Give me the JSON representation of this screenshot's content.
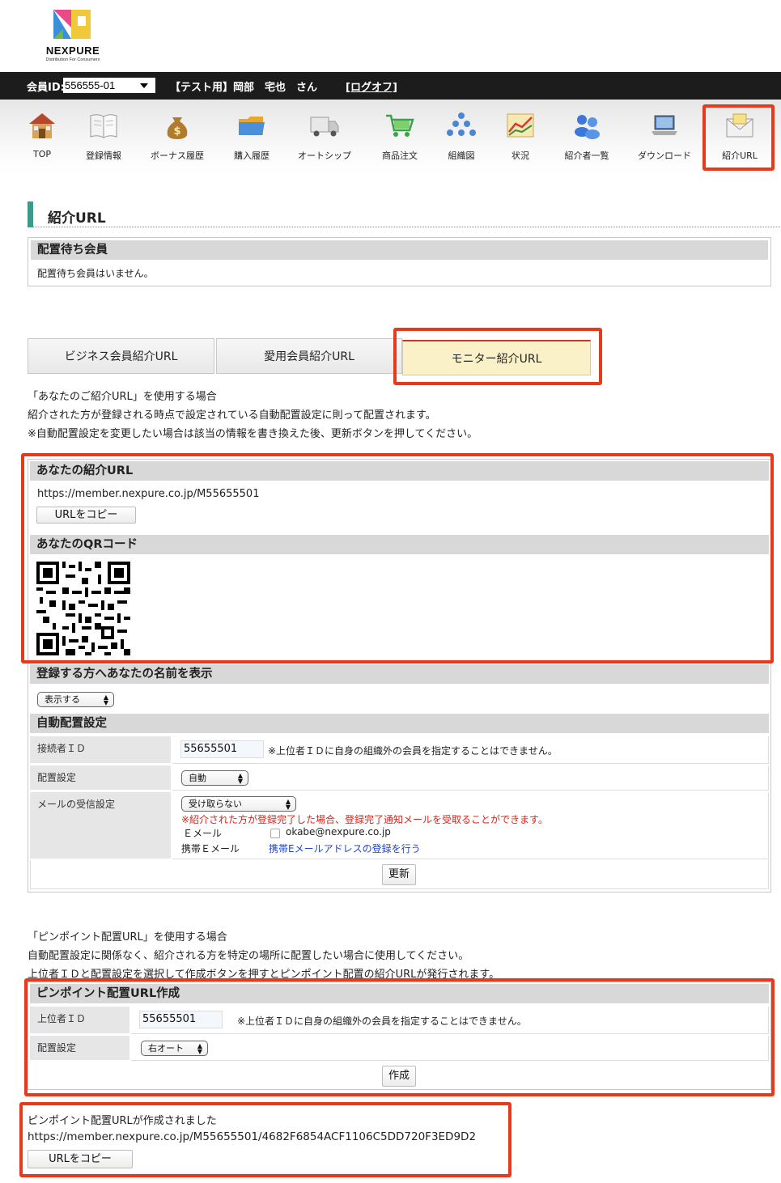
{
  "header": {
    "logo_text": "NEXPURE",
    "logo_sub": "Distribution For Consumers",
    "member_id_label": "会員ID:",
    "member_id_value": "556555-01",
    "user_name": "【テスト用】岡部　宅也　さん",
    "logoff": "[ログオフ]"
  },
  "nav": [
    {
      "label": "TOP",
      "icon": "house-icon"
    },
    {
      "label": "登録情報",
      "icon": "book-icon"
    },
    {
      "label": "ボーナス履歴",
      "icon": "money-bag-icon"
    },
    {
      "label": "購入履歴",
      "icon": "folder-icon"
    },
    {
      "label": "オートシップ",
      "icon": "truck-icon"
    },
    {
      "label": "商品注文",
      "icon": "cart-icon"
    },
    {
      "label": "組織図",
      "icon": "org-chart-icon"
    },
    {
      "label": "状況",
      "icon": "chart-icon"
    },
    {
      "label": "紹介者一覧",
      "icon": "people-icon"
    },
    {
      "label": "ダウンロード",
      "icon": "laptop-icon"
    },
    {
      "label": "紹介URL",
      "icon": "envelope-icon"
    }
  ],
  "page_title": "紹介URL",
  "waiting": {
    "heading": "配置待ち会員",
    "message": "配置待ち会員はいません。"
  },
  "tabs": [
    {
      "label": "ビジネス会員紹介URL"
    },
    {
      "label": "愛用会員紹介URL"
    },
    {
      "label": "モニター紹介URL"
    }
  ],
  "intro": {
    "line1": "「あなたのご紹介URL」を使用する場合",
    "line2": "紹介された方が登録される時点で設定されている自動配置設定に則って配置されます。",
    "line3": "※自動配置設定を変更したい場合は該当の情報を書き換えた後、更新ボタンを押してください。"
  },
  "your_url": {
    "heading": "あなたの紹介URL",
    "url": "https://member.nexpure.co.jp/M55655501",
    "copy_button": "URLをコピー"
  },
  "qr": {
    "heading": "あなたのQRコード"
  },
  "display_name": {
    "heading": "登録する方へあなたの名前を表示",
    "select_value": "表示する"
  },
  "auto_placement": {
    "heading": "自動配置設定",
    "connector_label": "接続者ＩＤ",
    "connector_value": "55655501",
    "connector_note": "※上位者ＩＤに自身の組織外の会員を指定することはできません。",
    "placement_label": "配置設定",
    "placement_value": "自動",
    "mail_label": "メールの受信設定",
    "mail_value": "受け取らない",
    "mail_note": "※紹介された方が登録完了した場合、登録完了通知メールを受取ることができます。",
    "email_label": "Ｅメール",
    "email_value": "okabe@nexpure.co.jp",
    "mobile_label": "携帯Ｅメール",
    "mobile_link": "携帯Eメールアドレスの登録を行う",
    "update_button": "更新"
  },
  "pinpoint_intro": {
    "line1": "「ピンポイント配置URL」を使用する場合",
    "line2": "自動配置設定に関係なく、紹介される方を特定の場所に配置したい場合に使用してください。",
    "line3": "上位者ＩＤと配置設定を選択して作成ボタンを押すとピンポイント配置の紹介URLが発行されます。"
  },
  "pinpoint": {
    "heading": "ピンポイント配置URL作成",
    "upper_label": "上位者ＩＤ",
    "upper_value": "55655501",
    "upper_note": "※上位者ＩＤに自身の組織外の会員を指定することはできません。",
    "placement_label": "配置設定",
    "placement_value": "右オート",
    "create_button": "作成"
  },
  "result": {
    "message": "ピンポイント配置URLが作成されました",
    "url": "https://member.nexpure.co.jp/M55655501/4682F6854ACF1106C5DD720F3ED9D2",
    "copy_button": "URLをコピー"
  },
  "colors": {
    "accent_teal": "#3b9b88",
    "highlight_red": "#e83a1a",
    "active_tab_bg": "#fbf1c9",
    "note_red": "#d8261c",
    "link_blue": "#2345c8"
  }
}
